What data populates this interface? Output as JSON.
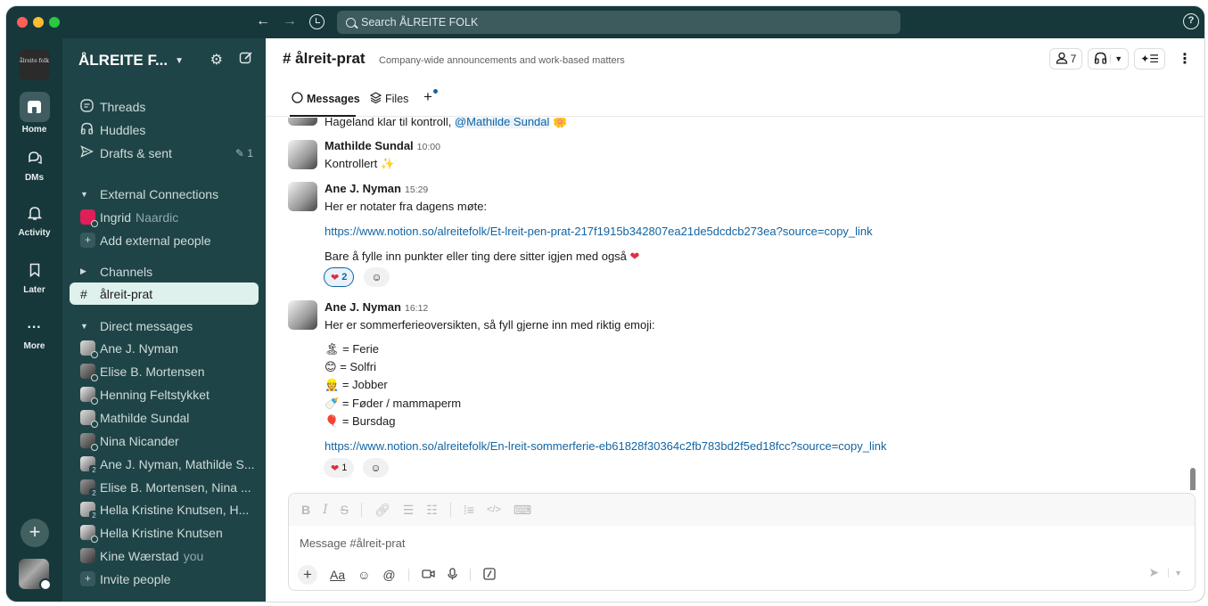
{
  "titlebar": {
    "search_placeholder": "Search ÅLREITE FOLK",
    "help": "?"
  },
  "rail": {
    "workspace_logo_text": "ålreite folk",
    "items": [
      {
        "label": "Home",
        "icon": "home-icon"
      },
      {
        "label": "DMs",
        "icon": "dm-icon"
      },
      {
        "label": "Activity",
        "icon": "bell-icon"
      },
      {
        "label": "Later",
        "icon": "bookmark-icon"
      },
      {
        "label": "More",
        "icon": "more-icon"
      }
    ]
  },
  "sidebar": {
    "workspace_name": "ÅLREITE F...",
    "nav": [
      {
        "label": "Threads",
        "icon": "threads-icon"
      },
      {
        "label": "Huddles",
        "icon": "headphones-icon"
      },
      {
        "label": "Drafts & sent",
        "icon": "send-icon",
        "count": "1"
      }
    ],
    "external": {
      "header": "External Connections",
      "contact_name": "Ingrid",
      "contact_org": "Naardic",
      "add": "Add external people"
    },
    "channels": {
      "header": "Channels",
      "items": [
        "ålreit-prat"
      ]
    },
    "dms": {
      "header": "Direct messages",
      "items": [
        {
          "name": "Ane J. Nyman",
          "extra": ""
        },
        {
          "name": "Elise B. Mortensen",
          "extra": ""
        },
        {
          "name": "Henning Feltstykket",
          "extra": ""
        },
        {
          "name": "Mathilde Sundal",
          "extra": ""
        },
        {
          "name": "Nina Nicander",
          "extra": ""
        },
        {
          "name": "Ane J. Nyman, Mathilde S...",
          "extra": "2"
        },
        {
          "name": "Elise B. Mortensen, Nina ...",
          "extra": "2"
        },
        {
          "name": "Hella Kristine Knutsen, H...",
          "extra": "2"
        },
        {
          "name": "Hella Kristine Knutsen",
          "extra": ""
        },
        {
          "name": "Kine Wærstad",
          "extra": "you"
        }
      ],
      "invite": "Invite people"
    }
  },
  "channel": {
    "name": "# ålreit-prat",
    "description": "Company-wide announcements and work-based matters",
    "member_count": "7",
    "tabs": [
      {
        "label": "Messages",
        "icon": "message-icon"
      },
      {
        "label": "Files",
        "icon": "files-icon"
      }
    ]
  },
  "messages": {
    "partial_line": "Hageland klar til kontroll, ",
    "partial_mention": "@Mathilde Sundal",
    "m1": {
      "sender": "Mathilde Sundal",
      "time": "10:00",
      "text": "Kontrollert"
    },
    "m2": {
      "sender": "Ane J. Nyman",
      "time": "15:29",
      "text": "Her er notater fra dagens møte:",
      "link": "https://www.notion.so/alreitefolk/Et-lreit-pen-prat-217f1915b342807ea21de5dcdcb273ea?source=copy_link",
      "text2": "Bare å fylle inn punkter eller ting dere sitter igjen med også",
      "reaction_count": "2"
    },
    "m3": {
      "sender": "Ane J. Nyman",
      "time": "16:12",
      "text": "Her er sommerferieoversikten, så fyll gjerne inn med riktig emoji:",
      "legend": [
        {
          "emoji": "🏝",
          "label": "= Ferie"
        },
        {
          "emoji": "😊",
          "label": "= Solfri"
        },
        {
          "emoji": "👷",
          "label": "= Jobber"
        },
        {
          "emoji": "🍼",
          "label": "= Føder / mammaperm"
        },
        {
          "emoji": "🎈",
          "label": "= Bursdag"
        }
      ],
      "link": "https://www.notion.so/alreitefolk/En-lreit-sommerferie-eb61828f30364c2fb783bd2f5ed18fcc?source=copy_link",
      "reaction_count": "1"
    }
  },
  "composer": {
    "placeholder": "Message #ålreit-prat"
  },
  "colors": {
    "sidebar": "#1f4447",
    "rail": "#17383b",
    "link": "#1264a3",
    "active_channel_bg": "#dff1ec"
  }
}
